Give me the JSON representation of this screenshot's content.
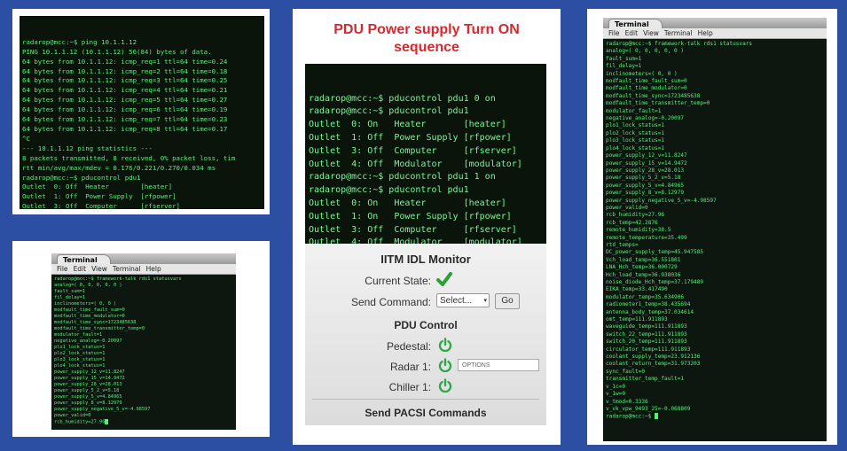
{
  "panel1": {
    "lines": [
      "radarop@mcc:~$ ping 10.1.1.12",
      "PING 10.1.1.12 (10.1.1.12) 56(84) bytes of data.",
      "64 bytes from 10.1.1.12: icmp_req=1 ttl=64 time=0.24",
      "64 bytes from 10.1.1.12: icmp_req=2 ttl=64 time=0.18",
      "64 bytes from 10.1.1.12: icmp_req=3 ttl=64 time=0.25",
      "64 bytes from 10.1.1.12: icmp_req=4 ttl=64 time=0.21",
      "64 bytes from 10.1.1.12: icmp_req=5 ttl=64 time=0.27",
      "64 bytes from 10.1.1.12: icmp_req=6 ttl=64 time=0.19",
      "64 bytes from 10.1.1.12: icmp_req=7 ttl=64 time=0.23",
      "64 bytes from 10.1.1.12: icmp_req=8 ttl=64 time=0.17",
      "^C",
      "--- 10.1.1.12 ping statistics ---",
      "8 packets transmitted, 8 received, 0% packet loss, tim",
      "rtt min/avg/max/mdev = 0.176/0.221/0.270/0.034 ms",
      "radarop@mcc:~$ pducontrol pdu1",
      "Outlet  0: Off  Heater        [heater]",
      "Outlet  1: Off  Power Supply  [rfpower]",
      "Outlet  3: Off  Computer      [rfserver]",
      "Outlet  4: Off  Modulator     [modulator]",
      "radarop@mcc:~$ "
    ]
  },
  "panel2": {
    "title": "PDU Power supply Turn ON sequence",
    "lines": [
      "radarop@mcc:~$ pducontrol pdu1 0 on",
      "radarop@mcc:~$ pducontrol pdu1",
      "Outlet  0: On   Heater       [heater]",
      "Outlet  1: Off  Power Supply [rfpower]",
      "Outlet  3: Off  Computer     [rfserver]",
      "Outlet  4: Off  Modulator    [modulator]",
      "radarop@mcc:~$ pducontrol pdu1 1 on",
      "radarop@mcc:~$ pducontrol pdu1",
      "Outlet  0: On   Heater       [heater]",
      "Outlet  1: On   Power Supply [rfpower]",
      "Outlet  3: Off  Computer     [rfserver]",
      "Outlet  4: Off  Modulator    [modulator]",
      "radarop@mcc:~$ "
    ],
    "monitor": {
      "heading": "IITM IDL Monitor",
      "current_state_label": "Current State:",
      "send_command_label": "Send Command:",
      "select_value": "Select...",
      "go_label": "Go",
      "pdu_heading": "PDU Control",
      "pedestal_label": "Pedestal:",
      "radar_label": "Radar 1:",
      "options_label": "OPTIONS",
      "chiller_label": "Chiller 1:",
      "pacsi_heading": "Send PACSI Commands",
      "check_color": "#2e9e3a",
      "power_color": "#2fa84a"
    }
  },
  "panel3": {
    "window_title": "Terminal",
    "menu": [
      "File",
      "Edit",
      "View",
      "Terminal",
      "Help"
    ],
    "lines": [
      "radarop@mcc:~$ framework-talk rds1 statusvars",
      "analog=( 0, 0, 0, 0, 0 )",
      "fault_sum=1",
      "fil_delay=1",
      "inclinometers=( 0, 0 )",
      "modfault_time_fault_sum=0",
      "modfault_time_modulator=0",
      "modfault_time_sync=1723485638",
      "modfault_time_transmitter_temp=0",
      "modulator_fault=1",
      "negative_analog=-0.20097",
      "plo1_lock_status=1",
      "plo2_lock_status=1",
      "plo3_lock_status=1",
      "plo4_lock_status=1",
      "power_supply_12_v=11.8247",
      "power_supply_15_v=14.9472",
      "power_supply_28_v=28.013",
      "power_supply_5_2_v=5.18",
      "power_supply_5_v=4.84965",
      "power_supply_8_v=8.12979",
      "power_supply_negative_5_v=-4.98597",
      "power_valid=0",
      "rcb_humidity=27.96"
    ]
  },
  "panel4": {
    "window_title": "Terminal",
    "menu": [
      "File",
      "Edit",
      "View",
      "Terminal",
      "Help"
    ],
    "lines": [
      "radarop@mcc:~$ framework-talk rds1 statusvars",
      "analog=( 0, 0, 0, 0, 0 )",
      "fault_sum=1",
      "fil_delay=1",
      "inclinometers=( 0, 0 )",
      "modfault_time_fault_sum=0",
      "modfault_time_modulator=0",
      "modfault_time_sync=1723485638",
      "modfault_time_transmitter_temp=0",
      "modulator_fault=1",
      "negative_analog=-0.20097",
      "plo1_lock_status=1",
      "plo2_lock_status=1",
      "plo3_lock_status=1",
      "plo4_lock_status=1",
      "power_supply_12_v=11.8247",
      "power_supply_15_v=14.9472",
      "power_supply_28_v=28.013",
      "power_supply_5_2_v=5.18",
      "power_supply_5_v=4.84965",
      "power_supply_8_v=8.12979",
      "power_supply_negative_5_v=-4.98597",
      "power_valid=0",
      "rcb_humidity=27.96",
      "rcb_temp=42.2876",
      "remote_humidity=38.5",
      "remote_temperature=35.499",
      "rtd_temps=",
      "DC_power_supply_temp=45.947585",
      "Vch_load_temp=36.551801",
      "LNA_Hch_temp=36.000729",
      "Hch_load_temp=36.938036",
      "noise_diode_Hch_temp=37.179489",
      "EIKA_temp=33.417490",
      "modulator_temp=35.634906",
      "radiometer1_temp=38.435694",
      "antenna_body_temp=37.034614",
      "omt_temp=111.911893",
      "waveguide_temp=111.911893",
      "switch_22_temp=111.911893",
      "switch_20_temp=111.911893",
      "circulator_temp=111.911893",
      "coolant_supply_temp=23.912136",
      "coolant_return_temp=31.973203",
      "sync_fault=0",
      "transmitter_temp_fault=1",
      "v_1c=0",
      "v_1w=0",
      "v_tmod=0.3336",
      "v_vk_vpw_9493_25=-0.068809",
      "radarop@mcc:~$ "
    ]
  }
}
